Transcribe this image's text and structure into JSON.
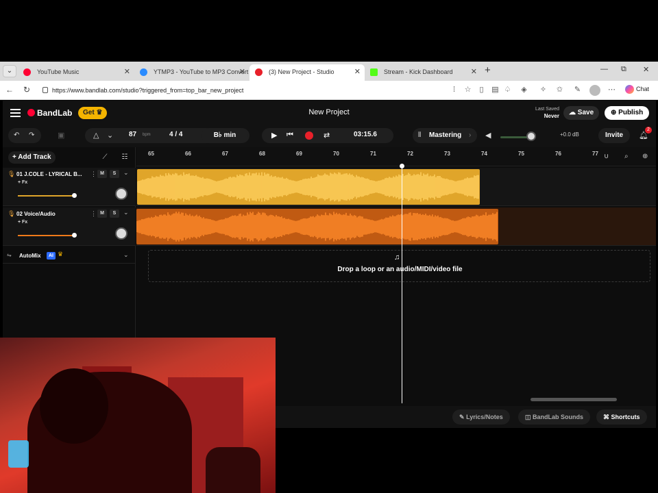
{
  "browser": {
    "tabs": [
      {
        "title": "YouTube Music",
        "color": "#ff0033"
      },
      {
        "title": "YTMP3 - YouTube to MP3 Convert",
        "color": "#2a8bff"
      },
      {
        "title": "(3) New Project - Studio",
        "color": "#e8202a"
      },
      {
        "title": "Stream - Kick Dashboard",
        "color": "#53fc18"
      }
    ],
    "url": "https://www.bandlab.com/studio?triggered_from=top_bar_new_project",
    "copilot_label": "Chat"
  },
  "app": {
    "logo": "BandLab",
    "get_label": "Get",
    "project_title": "New Project",
    "last_saved_label": "Last Saved",
    "last_saved_value": "Never",
    "save_label": "Save",
    "publish_label": "Publish"
  },
  "toolbar": {
    "tempo": "87",
    "tempo_unit": "bpm",
    "time_signature": "4 / 4",
    "key": "B♭ min",
    "time_display": "03:15.6",
    "mastering_label": "Mastering",
    "volume_db": "+0.0 dB",
    "volume_level": 0.85,
    "invite_label": "Invite",
    "notifications_count": "2"
  },
  "tracks_panel": {
    "add_track_label": "Add Track",
    "tracks": [
      {
        "name": "01  J.COLE - LYRICAL B...",
        "fx": "+ Fx",
        "mute": "M",
        "solo": "S",
        "color": "#e0a52a",
        "volume": 0.82
      },
      {
        "name": "02  Voice/Audio",
        "fx": "+ Fx",
        "mute": "M",
        "solo": "S",
        "color": "#f07a1a",
        "volume": 0.82
      }
    ],
    "automix_label": "AutoMix",
    "ai_badge": "AI"
  },
  "timeline": {
    "ruler_ticks": [
      "65",
      "66",
      "67",
      "68",
      "69",
      "70",
      "71",
      "72",
      "73",
      "74",
      "75",
      "76",
      "77"
    ],
    "drop_text": "Drop a loop or an audio/MIDI/video file"
  },
  "bottom": {
    "lyrics_label": "Lyrics/Notes",
    "sounds_label": "BandLab Sounds",
    "shortcuts_label": "Shortcuts"
  }
}
